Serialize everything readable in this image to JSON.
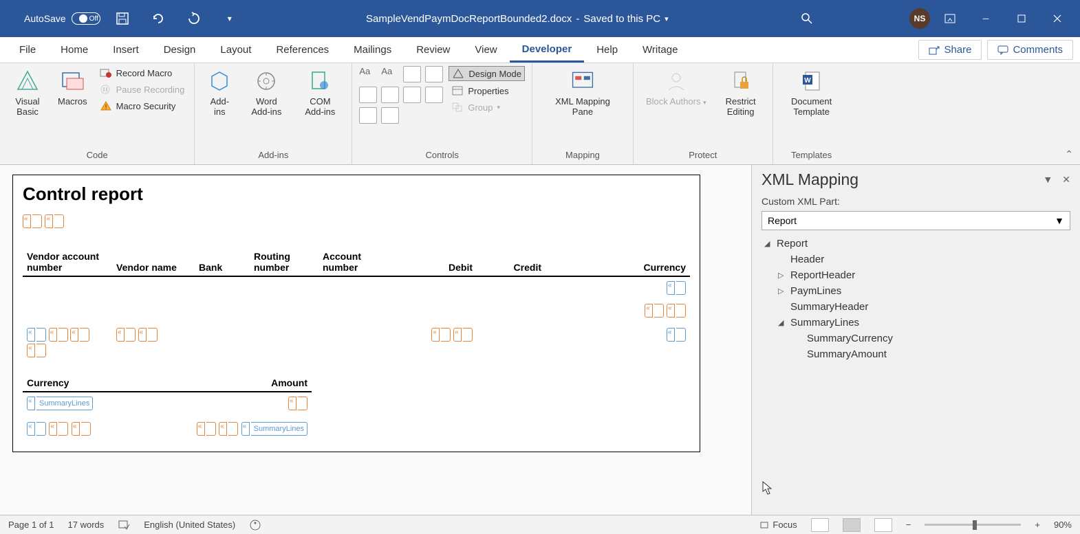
{
  "titlebar": {
    "autosave": "AutoSave",
    "autosave_state": "Off",
    "filename": "SampleVendPaymDocReportBounded2.docx",
    "status": "Saved to this PC",
    "user_initials": "NS"
  },
  "tabs": {
    "file": "File",
    "home": "Home",
    "insert": "Insert",
    "design": "Design",
    "layout": "Layout",
    "references": "References",
    "mailings": "Mailings",
    "review": "Review",
    "view": "View",
    "developer": "Developer",
    "help": "Help",
    "writage": "Writage",
    "share": "Share",
    "comments": "Comments"
  },
  "ribbon": {
    "code_group": "Code",
    "visual_basic": "Visual Basic",
    "macros": "Macros",
    "record_macro": "Record Macro",
    "pause_recording": "Pause Recording",
    "macro_security": "Macro Security",
    "addins_group": "Add-ins",
    "addins": "Add-ins",
    "word_addins": "Word Add-ins",
    "com_addins": "COM Add-ins",
    "controls_group": "Controls",
    "design_mode": "Design Mode",
    "properties": "Properties",
    "group": "Group",
    "mapping_group": "Mapping",
    "xml_mapping_pane": "XML Mapping Pane",
    "protect_group": "Protect",
    "block_authors": "Block Authors",
    "restrict_editing": "Restrict Editing",
    "templates_group": "Templates",
    "document_template": "Document Template"
  },
  "document": {
    "title": "Control report",
    "table_headers": {
      "vendor_account": "Vendor account number",
      "vendor_name": "Vendor name",
      "bank": "Bank",
      "routing_number": "Routing number",
      "account_number": "Account number",
      "debit": "Debit",
      "credit": "Credit",
      "currency": "Currency"
    },
    "summary_headers": {
      "currency": "Currency",
      "amount": "Amount"
    },
    "cc_labels": {
      "summary_lines": "SummaryLines"
    }
  },
  "xml_pane": {
    "title": "XML Mapping",
    "label": "Custom XML Part:",
    "selected": "Report",
    "tree": {
      "report": "Report",
      "header": "Header",
      "report_header": "ReportHeader",
      "paym_lines": "PaymLines",
      "summary_header": "SummaryHeader",
      "summary_lines": "SummaryLines",
      "summary_currency": "SummaryCurrency",
      "summary_amount": "SummaryAmount"
    }
  },
  "statusbar": {
    "page": "Page 1 of 1",
    "words": "17 words",
    "language": "English (United States)",
    "focus": "Focus",
    "zoom": "90%"
  }
}
